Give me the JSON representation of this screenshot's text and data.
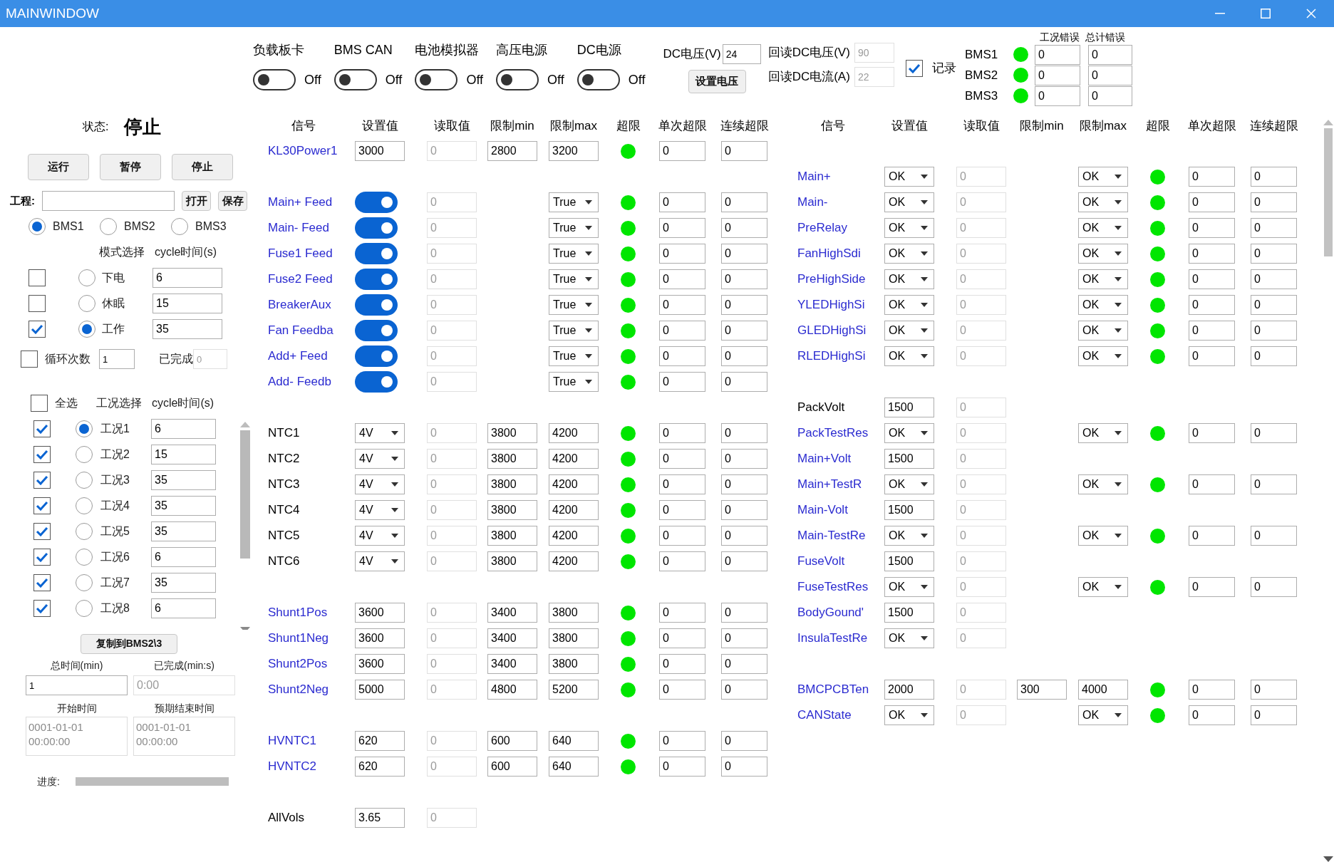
{
  "window": {
    "title": "MAINWINDOW"
  },
  "switches": [
    {
      "label": "负载板卡",
      "on": false,
      "state_text": "Off"
    },
    {
      "label": "BMS CAN",
      "on": false,
      "state_text": "Off"
    },
    {
      "label": "电池模拟器",
      "on": false,
      "state_text": "Off"
    },
    {
      "label": "高压电源",
      "on": false,
      "state_text": "Off"
    },
    {
      "label": "DC电源",
      "on": false,
      "state_text": "Off"
    }
  ],
  "dc_supply": {
    "voltage_label": "DC电压(V)",
    "voltage": "24",
    "set_button": "设置电压",
    "readback_voltage_label": "回读DC电压(V)",
    "readback_voltage": "90",
    "readback_current_label": "回读DC电流(A)",
    "readback_current": "22"
  },
  "record": {
    "label": "记录",
    "checked": true
  },
  "bms_errors": {
    "columns": [
      "工况错误",
      "总计错误"
    ],
    "rows": [
      {
        "name": "BMS1",
        "ok": true,
        "case_errors": "0",
        "total_errors": "0"
      },
      {
        "name": "BMS2",
        "ok": true,
        "case_errors": "0",
        "total_errors": "0"
      },
      {
        "name": "BMS3",
        "ok": true,
        "case_errors": "0",
        "total_errors": "0"
      }
    ]
  },
  "status": {
    "label": "状态:",
    "value": "停止"
  },
  "control_buttons": [
    "运行",
    "暂停",
    "停止"
  ],
  "project": {
    "label": "工程:",
    "buttons": [
      "打开",
      "保存"
    ]
  },
  "bms_select": [
    {
      "label": "BMS1",
      "selected": true
    },
    {
      "label": "BMS2",
      "selected": false
    },
    {
      "label": "BMS3",
      "selected": false
    }
  ],
  "modes": {
    "columns": [
      "模式选择",
      "cycle时间(s)"
    ],
    "rows": [
      {
        "checked": false,
        "selected": false,
        "label": "下电",
        "cycle": "6"
      },
      {
        "checked": false,
        "selected": false,
        "label": "休眠",
        "cycle": "15"
      },
      {
        "checked": true,
        "selected": true,
        "label": "工作",
        "cycle": "35"
      }
    ]
  },
  "loop": {
    "checked": false,
    "label": "循环次数",
    "count": "1",
    "done_label": "已完成",
    "done": "0"
  },
  "cases": {
    "select_all": {
      "checked": false,
      "label": "全选"
    },
    "columns": [
      "工况选择",
      "cycle时间(s)"
    ],
    "rows": [
      {
        "checked": true,
        "selected": true,
        "label": "工况1",
        "cycle": "6"
      },
      {
        "checked": true,
        "selected": false,
        "label": "工况2",
        "cycle": "15"
      },
      {
        "checked": true,
        "selected": false,
        "label": "工况3",
        "cycle": "35"
      },
      {
        "checked": true,
        "selected": false,
        "label": "工况4",
        "cycle": "35"
      },
      {
        "checked": true,
        "selected": false,
        "label": "工况5",
        "cycle": "35"
      },
      {
        "checked": true,
        "selected": false,
        "label": "工况6",
        "cycle": "6"
      },
      {
        "checked": true,
        "selected": false,
        "label": "工况7",
        "cycle": "35"
      },
      {
        "checked": true,
        "selected": false,
        "label": "工况8",
        "cycle": "6"
      }
    ]
  },
  "copy_button": "复制到BMS2\\3",
  "timing": {
    "total_label": "总时间(min)",
    "total": "1",
    "done_label": "已完成(min:s)",
    "done": "0:00",
    "start_label": "开始时间",
    "start": "0001-01-01\n00:00:00",
    "end_label": "预期结束时间",
    "end": "0001-01-01\n00:00:00"
  },
  "progress": {
    "label": "进度:",
    "level": 0
  },
  "tables": [
    {
      "columns": [
        "信号",
        "设置值",
        "读取值",
        "限制min",
        "限制max",
        "超限",
        "单次超限",
        "连续超限"
      ],
      "groups": [
        [
          {
            "signal": "KL30Power1",
            "color": "#2b2bd0",
            "setting": {
              "kind": "input",
              "value": "3000"
            },
            "read": "0",
            "min": "2800",
            "max": {
              "kind": "input",
              "value": "3200"
            },
            "over_limit": false,
            "single": "0",
            "continuous": "0"
          }
        ],
        [
          {
            "signal": "Main+ Feed",
            "color": "#2b2bd0",
            "setting": {
              "kind": "toggle",
              "on": true
            },
            "read": "0",
            "max": {
              "kind": "dropdown",
              "value": "True"
            },
            "over_limit": false,
            "single": "0",
            "continuous": "0"
          },
          {
            "signal": "Main- Feed",
            "color": "#2b2bd0",
            "setting": {
              "kind": "toggle",
              "on": true
            },
            "read": "0",
            "max": {
              "kind": "dropdown",
              "value": "True"
            },
            "over_limit": false,
            "single": "0",
            "continuous": "0"
          },
          {
            "signal": "Fuse1 Feed",
            "color": "#2b2bd0",
            "setting": {
              "kind": "toggle",
              "on": true
            },
            "read": "0",
            "max": {
              "kind": "dropdown",
              "value": "True"
            },
            "over_limit": false,
            "single": "0",
            "continuous": "0"
          },
          {
            "signal": "Fuse2 Feed",
            "color": "#2b2bd0",
            "setting": {
              "kind": "toggle",
              "on": true
            },
            "read": "0",
            "max": {
              "kind": "dropdown",
              "value": "True"
            },
            "over_limit": false,
            "single": "0",
            "continuous": "0"
          },
          {
            "signal": "BreakerAux",
            "color": "#2b2bd0",
            "setting": {
              "kind": "toggle",
              "on": true
            },
            "read": "0",
            "max": {
              "kind": "dropdown",
              "value": "True"
            },
            "over_limit": false,
            "single": "0",
            "continuous": "0"
          },
          {
            "signal": "Fan Feedba",
            "color": "#2b2bd0",
            "setting": {
              "kind": "toggle",
              "on": true
            },
            "read": "0",
            "max": {
              "kind": "dropdown",
              "value": "True"
            },
            "over_limit": false,
            "single": "0",
            "continuous": "0"
          },
          {
            "signal": "Add+ Feed",
            "color": "#2b2bd0",
            "setting": {
              "kind": "toggle",
              "on": true
            },
            "read": "0",
            "max": {
              "kind": "dropdown",
              "value": "True"
            },
            "over_limit": false,
            "single": "0",
            "continuous": "0"
          },
          {
            "signal": "Add- Feedb",
            "color": "#2b2bd0",
            "setting": {
              "kind": "toggle",
              "on": true
            },
            "read": "0",
            "max": {
              "kind": "dropdown",
              "value": "True"
            },
            "over_limit": false,
            "single": "0",
            "continuous": "0"
          }
        ],
        [
          {
            "signal": "NTC1",
            "color": "#000000",
            "setting": {
              "kind": "dropdown",
              "value": "4V"
            },
            "read": "0",
            "min": "3800",
            "max": {
              "kind": "input",
              "value": "4200"
            },
            "over_limit": false,
            "single": "0",
            "continuous": "0"
          },
          {
            "signal": "NTC2",
            "color": "#000000",
            "setting": {
              "kind": "dropdown",
              "value": "4V"
            },
            "read": "0",
            "min": "3800",
            "max": {
              "kind": "input",
              "value": "4200"
            },
            "over_limit": false,
            "single": "0",
            "continuous": "0"
          },
          {
            "signal": "NTC3",
            "color": "#000000",
            "setting": {
              "kind": "dropdown",
              "value": "4V"
            },
            "read": "0",
            "min": "3800",
            "max": {
              "kind": "input",
              "value": "4200"
            },
            "over_limit": false,
            "single": "0",
            "continuous": "0"
          },
          {
            "signal": "NTC4",
            "color": "#000000",
            "setting": {
              "kind": "dropdown",
              "value": "4V"
            },
            "read": "0",
            "min": "3800",
            "max": {
              "kind": "input",
              "value": "4200"
            },
            "over_limit": false,
            "single": "0",
            "continuous": "0"
          },
          {
            "signal": "NTC5",
            "color": "#000000",
            "setting": {
              "kind": "dropdown",
              "value": "4V"
            },
            "read": "0",
            "min": "3800",
            "max": {
              "kind": "input",
              "value": "4200"
            },
            "over_limit": false,
            "single": "0",
            "continuous": "0"
          },
          {
            "signal": "NTC6",
            "color": "#000000",
            "setting": {
              "kind": "dropdown",
              "value": "4V"
            },
            "read": "0",
            "min": "3800",
            "max": {
              "kind": "input",
              "value": "4200"
            },
            "over_limit": false,
            "single": "0",
            "continuous": "0"
          }
        ],
        [
          {
            "signal": "Shunt1Pos",
            "color": "#2b2bd0",
            "setting": {
              "kind": "input",
              "value": "3600"
            },
            "read": "0",
            "min": "3400",
            "max": {
              "kind": "input",
              "value": "3800"
            },
            "over_limit": false,
            "single": "0",
            "continuous": "0"
          },
          {
            "signal": "Shunt1Neg",
            "color": "#2b2bd0",
            "setting": {
              "kind": "input",
              "value": "3600"
            },
            "read": "0",
            "min": "3400",
            "max": {
              "kind": "input",
              "value": "3800"
            },
            "over_limit": false,
            "single": "0",
            "continuous": "0"
          },
          {
            "signal": "Shunt2Pos",
            "color": "#2b2bd0",
            "setting": {
              "kind": "input",
              "value": "3600"
            },
            "read": "0",
            "min": "3400",
            "max": {
              "kind": "input",
              "value": "3800"
            },
            "over_limit": false,
            "single": "0",
            "continuous": "0"
          },
          {
            "signal": "Shunt2Neg",
            "color": "#2b2bd0",
            "setting": {
              "kind": "input",
              "value": "5000"
            },
            "read": "0",
            "min": "4800",
            "max": {
              "kind": "input",
              "value": "5200"
            },
            "over_limit": false,
            "single": "0",
            "continuous": "0"
          }
        ],
        [
          {
            "signal": "HVNTC1",
            "color": "#2b2bd0",
            "setting": {
              "kind": "input",
              "value": "620"
            },
            "read": "0",
            "min": "600",
            "max": {
              "kind": "input",
              "value": "640"
            },
            "over_limit": false,
            "single": "0",
            "continuous": "0"
          },
          {
            "signal": "HVNTC2",
            "color": "#2b2bd0",
            "setting": {
              "kind": "input",
              "value": "620"
            },
            "read": "0",
            "min": "600",
            "max": {
              "kind": "input",
              "value": "640"
            },
            "over_limit": false,
            "single": "0",
            "continuous": "0"
          }
        ],
        [
          {
            "signal": "AllVols",
            "color": "#000000",
            "setting": {
              "kind": "input",
              "value": "3.65"
            },
            "read": "0"
          }
        ]
      ]
    },
    {
      "columns": [
        "信号",
        "设置值",
        "读取值",
        "限制min",
        "限制max",
        "超限",
        "单次超限",
        "连续超限"
      ],
      "groups": [
        [
          {
            "signal": "Main+",
            "color": "#2b2bd0",
            "setting": {
              "kind": "dropdown",
              "value": "OK"
            },
            "read": "0",
            "max": {
              "kind": "dropdown",
              "value": "OK"
            },
            "over_limit": false,
            "single": "0",
            "continuous": "0"
          },
          {
            "signal": "Main-",
            "color": "#2b2bd0",
            "setting": {
              "kind": "dropdown",
              "value": "OK"
            },
            "read": "0",
            "max": {
              "kind": "dropdown",
              "value": "OK"
            },
            "over_limit": false,
            "single": "0",
            "continuous": "0"
          },
          {
            "signal": "PreRelay",
            "color": "#2b2bd0",
            "setting": {
              "kind": "dropdown",
              "value": "OK"
            },
            "read": "0",
            "max": {
              "kind": "dropdown",
              "value": "OK"
            },
            "over_limit": false,
            "single": "0",
            "continuous": "0"
          },
          {
            "signal": "FanHighSdi",
            "color": "#2b2bd0",
            "setting": {
              "kind": "dropdown",
              "value": "OK"
            },
            "read": "0",
            "max": {
              "kind": "dropdown",
              "value": "OK"
            },
            "over_limit": false,
            "single": "0",
            "continuous": "0"
          },
          {
            "signal": "PreHighSide",
            "color": "#2b2bd0",
            "setting": {
              "kind": "dropdown",
              "value": "OK"
            },
            "read": "0",
            "max": {
              "kind": "dropdown",
              "value": "OK"
            },
            "over_limit": false,
            "single": "0",
            "continuous": "0"
          },
          {
            "signal": "YLEDHighSi",
            "color": "#2b2bd0",
            "setting": {
              "kind": "dropdown",
              "value": "OK"
            },
            "read": "0",
            "max": {
              "kind": "dropdown",
              "value": "OK"
            },
            "over_limit": false,
            "single": "0",
            "continuous": "0"
          },
          {
            "signal": "GLEDHighSi",
            "color": "#2b2bd0",
            "setting": {
              "kind": "dropdown",
              "value": "OK"
            },
            "read": "0",
            "max": {
              "kind": "dropdown",
              "value": "OK"
            },
            "over_limit": false,
            "single": "0",
            "continuous": "0"
          },
          {
            "signal": "RLEDHighSi",
            "color": "#2b2bd0",
            "setting": {
              "kind": "dropdown",
              "value": "OK"
            },
            "read": "0",
            "max": {
              "kind": "dropdown",
              "value": "OK"
            },
            "over_limit": false,
            "single": "0",
            "continuous": "0"
          }
        ],
        [
          {
            "signal": "PackVolt",
            "color": "#000000",
            "setting": {
              "kind": "input",
              "value": "1500"
            },
            "read": "0"
          },
          {
            "signal": "PackTestRes",
            "color": "#2b2bd0",
            "setting": {
              "kind": "dropdown",
              "value": "OK"
            },
            "read": "0",
            "max": {
              "kind": "dropdown",
              "value": "OK"
            },
            "over_limit": false,
            "single": "0",
            "continuous": "0"
          },
          {
            "signal": "Main+Volt",
            "color": "#2b2bd0",
            "setting": {
              "kind": "input",
              "value": "1500"
            },
            "read": "0"
          },
          {
            "signal": "Main+TestR",
            "color": "#2b2bd0",
            "setting": {
              "kind": "dropdown",
              "value": "OK"
            },
            "read": "0",
            "max": {
              "kind": "dropdown",
              "value": "OK"
            },
            "over_limit": false,
            "single": "0",
            "continuous": "0"
          },
          {
            "signal": "Main-Volt",
            "color": "#2b2bd0",
            "setting": {
              "kind": "input",
              "value": "1500"
            },
            "read": "0"
          },
          {
            "signal": "Main-TestRe",
            "color": "#2b2bd0",
            "setting": {
              "kind": "dropdown",
              "value": "OK"
            },
            "read": "0",
            "max": {
              "kind": "dropdown",
              "value": "OK"
            },
            "over_limit": false,
            "single": "0",
            "continuous": "0"
          },
          {
            "signal": "FuseVolt",
            "color": "#2b2bd0",
            "setting": {
              "kind": "input",
              "value": "1500"
            },
            "read": "0"
          },
          {
            "signal": "FuseTestRes",
            "color": "#2b2bd0",
            "setting": {
              "kind": "dropdown",
              "value": "OK"
            },
            "read": "0",
            "max": {
              "kind": "dropdown",
              "value": "OK"
            },
            "over_limit": false,
            "single": "0",
            "continuous": "0"
          },
          {
            "signal": "BodyGound'",
            "color": "#2b2bd0",
            "setting": {
              "kind": "input",
              "value": "1500"
            },
            "read": "0"
          },
          {
            "signal": "InsulaTestRe",
            "color": "#2b2bd0",
            "setting": {
              "kind": "dropdown",
              "value": "OK"
            },
            "read": "0"
          }
        ],
        [
          {
            "signal": "BMCPCBTen",
            "color": "#2b2bd0",
            "setting": {
              "kind": "input",
              "value": "2000"
            },
            "read": "0",
            "min": "300",
            "max": {
              "kind": "input",
              "value": "4000"
            },
            "over_limit": false,
            "single": "0",
            "continuous": "0"
          },
          {
            "signal": "CANState",
            "color": "#2b2bd0",
            "setting": {
              "kind": "dropdown",
              "value": "OK"
            },
            "read": "0",
            "max": {
              "kind": "dropdown",
              "value": "OK"
            },
            "over_limit": false,
            "single": "0",
            "continuous": "0"
          }
        ]
      ]
    }
  ]
}
